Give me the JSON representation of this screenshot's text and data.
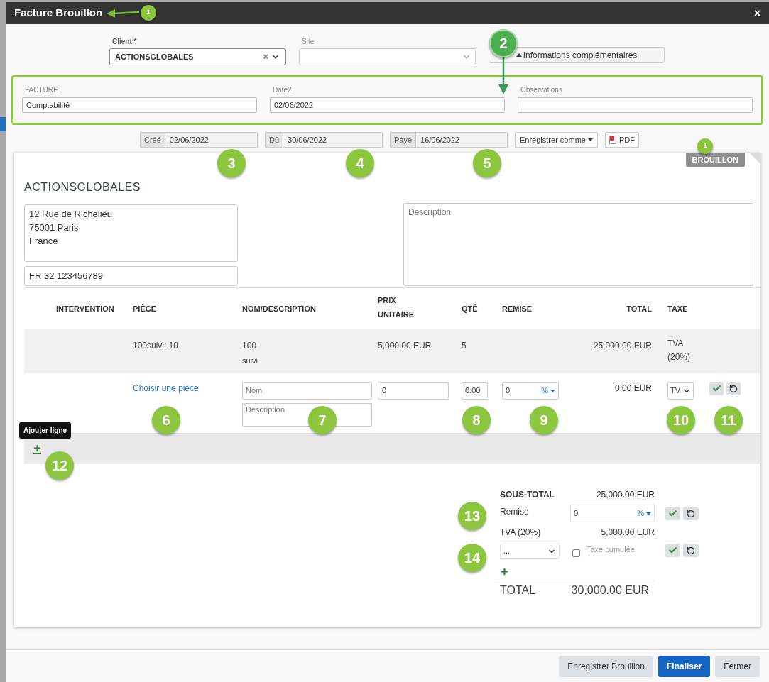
{
  "header": {
    "title": "Facture Brouillon",
    "close": "×"
  },
  "client": {
    "label": "Client *",
    "value": "ACTIONSGLOBALES",
    "clear": "×"
  },
  "site": {
    "label": "Site"
  },
  "more_info_button": "Informations complémentaires",
  "extra_fields": [
    {
      "label": "FACTURE",
      "value": "Comptabilité"
    },
    {
      "label": "Date2",
      "value": "02/06/2022"
    },
    {
      "label": "Observations"
    }
  ],
  "dates": [
    {
      "label": "Créé",
      "value": "02/06/2022"
    },
    {
      "label": "Dû",
      "value": "30/06/2022"
    },
    {
      "label": "Payé",
      "value": "16/06/2022"
    }
  ],
  "save_as_button": "Enregistrer comme",
  "pdf_button": "PDF",
  "status": "BROUILLON",
  "customer": {
    "name": "ACTIONSGLOBALES",
    "address": "12 Rue de Richelieu\n75001 Paris\nFrance",
    "vat_number": "FR 32 123456789",
    "description_placeholder": "Description"
  },
  "table": {
    "columns": [
      "INTERVENTION",
      "PIÈCE",
      "NOM/DESCRIPTION",
      "PRIX UNITAIRE",
      "QTÉ",
      "REMISE",
      "TOTAL",
      "TAXE"
    ],
    "rows": [
      {
        "piece": "100suivi: 10",
        "name": "100",
        "description": "suivi",
        "unit_price": "5,000.00 EUR",
        "quantity": "5",
        "total": "25,000.00 EUR",
        "tax": "TVA (20%)"
      }
    ]
  },
  "new_line": {
    "piece_link": "Choisir une pièce",
    "name_placeholder": "Nom",
    "description_placeholder": "Description",
    "unit_price": "0",
    "quantity": "0.00",
    "discount": "0",
    "discount_unit": "%",
    "total": "0.00 EUR",
    "tax": "TV"
  },
  "add_line_tooltip": "Ajouter ligne",
  "totals": {
    "subtotal_label": "SOUS-TOTAL",
    "subtotal": "25,000.00 EUR",
    "discount_label": "Remise",
    "discount": "0",
    "discount_unit": "%",
    "tax_label": "TVA (20%)",
    "tax_amount": "5,000.00 EUR",
    "tax_select": "...",
    "cumulative_tax": {
      "label": "Taxe cumulée",
      "checked": false
    },
    "total_label": "TOTAL",
    "total": "30,000.00 EUR"
  },
  "footer_buttons": [
    {
      "label": "Enregistrer Brouillon",
      "kind": "secondary"
    },
    {
      "label": "Finaliser",
      "kind": "primary"
    },
    {
      "label": "Fermer",
      "kind": "secondary"
    }
  ],
  "callouts": [
    {
      "label": "1",
      "kind": "small",
      "arrowed": true
    },
    {
      "label": "2",
      "kind": "large",
      "arrowed": true
    },
    {
      "label": "3",
      "kind": "large"
    },
    {
      "label": "4",
      "kind": "large"
    },
    {
      "label": "5",
      "kind": "large"
    },
    {
      "label": "1",
      "kind": "small"
    },
    {
      "label": "6",
      "kind": "large"
    },
    {
      "label": "7",
      "kind": "large"
    },
    {
      "label": "8",
      "kind": "large"
    },
    {
      "label": "9",
      "kind": "large"
    },
    {
      "label": "10",
      "kind": "large"
    },
    {
      "label": "11",
      "kind": "large"
    },
    {
      "label": "12",
      "kind": "large"
    },
    {
      "label": "13",
      "kind": "large"
    },
    {
      "label": "14",
      "kind": "large"
    }
  ]
}
